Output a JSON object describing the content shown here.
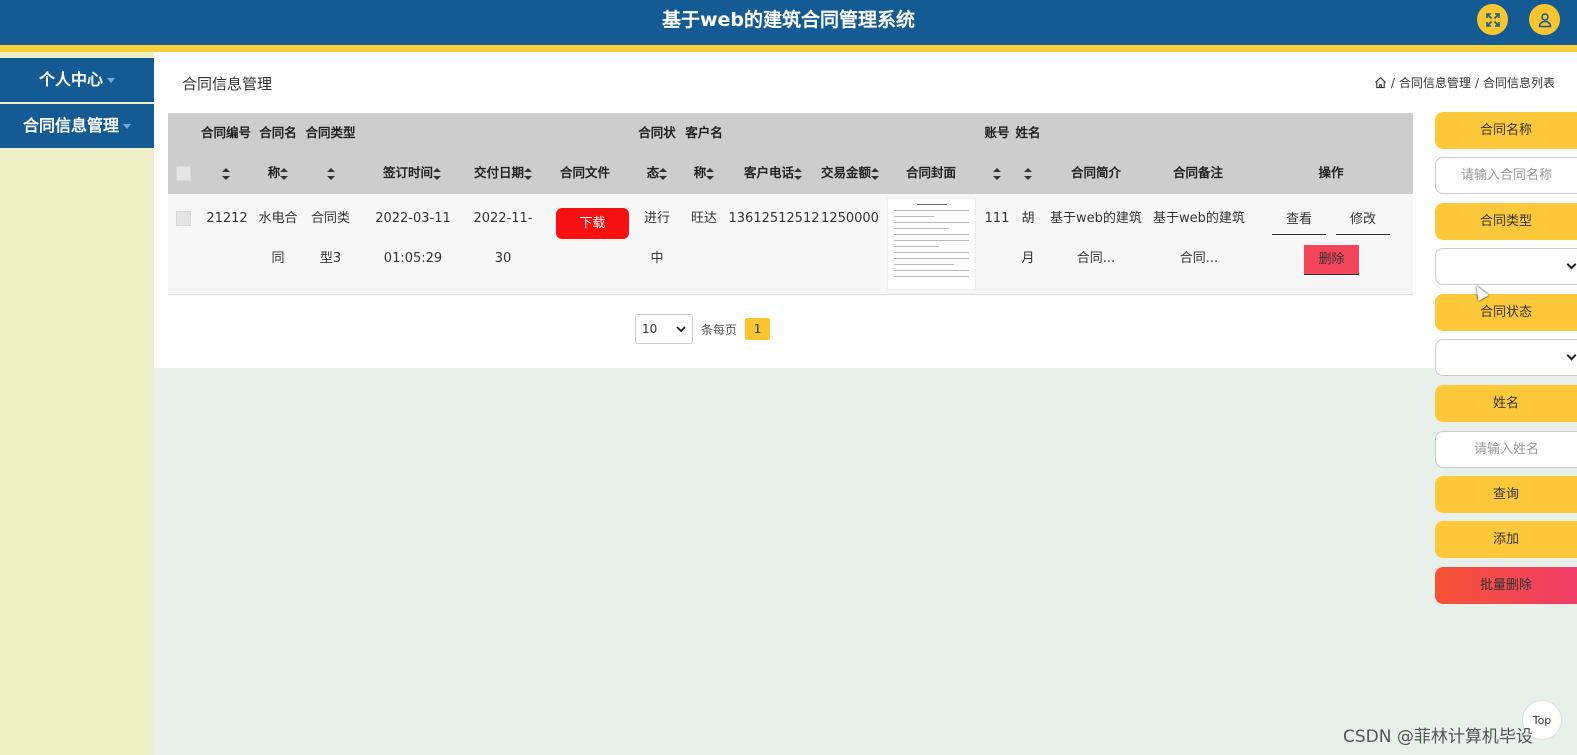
{
  "header": {
    "title": "基于web的建筑合同管理系统",
    "fullscreen_icon": "expand-icon",
    "user_icon": "user-icon"
  },
  "sidebar": {
    "items": [
      {
        "label": "个人中心"
      },
      {
        "label": "合同信息管理"
      }
    ]
  },
  "page": {
    "title": "合同信息管理"
  },
  "breadcrumb": {
    "home_icon": "home-icon",
    "items": [
      "合同信息管理",
      "合同信息列表"
    ],
    "separator": "/"
  },
  "table": {
    "columns": [
      {
        "line1": "合同编号",
        "line2": ""
      },
      {
        "line1": "合同名",
        "line2": "称"
      },
      {
        "line1": "合同类型",
        "line2": ""
      },
      {
        "line1": "",
        "line2": "签订时间"
      },
      {
        "line1": "",
        "line2": "交付日期"
      },
      {
        "line1": "",
        "line2": "合同文件"
      },
      {
        "line1": "合同状",
        "line2": "态"
      },
      {
        "line1": "客户名",
        "line2": "称"
      },
      {
        "line1": "",
        "line2": "客户电话"
      },
      {
        "line1": "",
        "line2": "交易金额"
      },
      {
        "line1": "",
        "line2": "合同封面"
      },
      {
        "line1": "账号",
        "line2": ""
      },
      {
        "line1": "姓名",
        "line2": ""
      },
      {
        "line1": "",
        "line2": "合同简介"
      },
      {
        "line1": "",
        "line2": "合同备注"
      },
      {
        "line1": "",
        "line2": "操作"
      }
    ],
    "row": {
      "contract_no": "21212",
      "name_l1": "水电合",
      "name_l2": "同",
      "type_l1": "合同类",
      "type_l2": "型3",
      "sign_l1": "2022-03-11",
      "sign_l2": "01:05:29",
      "deliver_l1": "2022-11-",
      "deliver_l2": "30",
      "download": "下载",
      "status_l1": "进行",
      "status_l2": "中",
      "customer": "旺达",
      "phone": "13612512512",
      "amount": "1250000",
      "account": "111",
      "person_l1": "胡",
      "person_l2": "月",
      "intro_l1": "基于web的建筑",
      "intro_l2": "合同...",
      "remark_l1": "基于web的建筑",
      "remark_l2": "合同...",
      "view": "查看",
      "edit": "修改",
      "delete": "删除"
    }
  },
  "pagination": {
    "page_size": "10",
    "per_page_label": "条每页",
    "current_page": "1"
  },
  "search": {
    "contract_name_label": "合同名称",
    "contract_name_placeholder": "请输入合同名称",
    "contract_type_label": "合同类型",
    "contract_status_label": "合同状态",
    "person_label": "姓名",
    "person_placeholder": "请输入姓名",
    "query": "查询",
    "add": "添加",
    "batch_delete": "批量删除"
  },
  "footer": {
    "top_button": "Top",
    "watermark": "CSDN @菲林计算机毕设"
  }
}
